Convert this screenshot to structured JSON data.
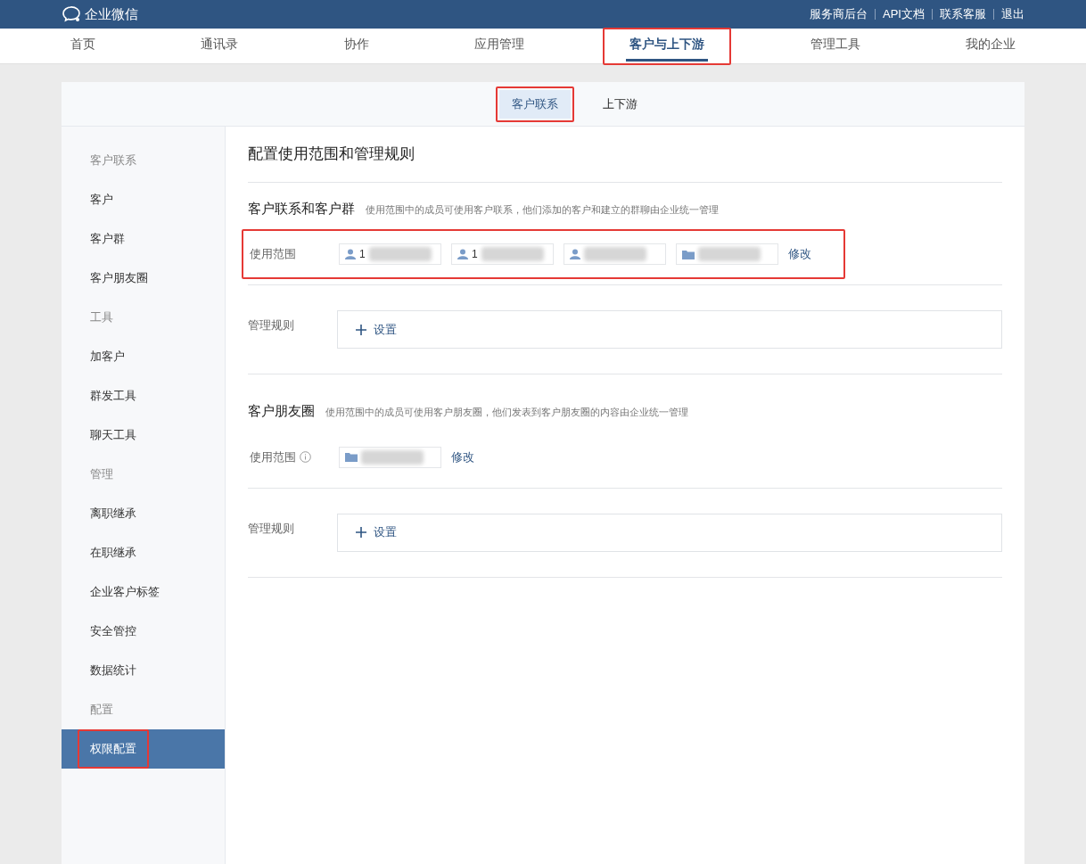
{
  "topbar": {
    "logo": "企业微信",
    "links": [
      "服务商后台",
      "API文档",
      "联系客服",
      "退出"
    ]
  },
  "nav": [
    {
      "label": "首页",
      "selected": false,
      "highlighted": false
    },
    {
      "label": "通讯录",
      "selected": false,
      "highlighted": false
    },
    {
      "label": "协作",
      "selected": false,
      "highlighted": false
    },
    {
      "label": "应用管理",
      "selected": false,
      "highlighted": false
    },
    {
      "label": "客户与上下游",
      "selected": true,
      "highlighted": true
    },
    {
      "label": "管理工具",
      "selected": false,
      "highlighted": false
    },
    {
      "label": "我的企业",
      "selected": false,
      "highlighted": false
    }
  ],
  "subtabs": [
    {
      "label": "客户联系",
      "selected": true,
      "highlighted": true
    },
    {
      "label": "上下游",
      "selected": false,
      "highlighted": false
    }
  ],
  "sidebar": [
    {
      "heading": "客户联系",
      "items": [
        {
          "label": "客户",
          "selected": false,
          "highlighted": false
        },
        {
          "label": "客户群",
          "selected": false,
          "highlighted": false
        },
        {
          "label": "客户朋友圈",
          "selected": false,
          "highlighted": false
        }
      ]
    },
    {
      "heading": "工具",
      "items": [
        {
          "label": "加客户",
          "selected": false,
          "highlighted": false
        },
        {
          "label": "群发工具",
          "selected": false,
          "highlighted": false
        },
        {
          "label": "聊天工具",
          "selected": false,
          "highlighted": false
        }
      ]
    },
    {
      "heading": "管理",
      "items": [
        {
          "label": "离职继承",
          "selected": false,
          "highlighted": false
        },
        {
          "label": "在职继承",
          "selected": false,
          "highlighted": false
        },
        {
          "label": "企业客户标签",
          "selected": false,
          "highlighted": false
        },
        {
          "label": "安全管控",
          "selected": false,
          "highlighted": false
        },
        {
          "label": "数据统计",
          "selected": false,
          "highlighted": false
        }
      ]
    },
    {
      "heading": "配置",
      "items": [
        {
          "label": "权限配置",
          "selected": true,
          "highlighted": true
        }
      ]
    }
  ],
  "page_title": "配置使用范围和管理规则",
  "sections": [
    {
      "title": "客户联系和客户群",
      "description": "使用范围中的成员可使用客户联系，他们添加的客户和建立的群聊由企业统一管理",
      "scope": {
        "label": "使用范围",
        "info": false,
        "highlighted": true,
        "chips": [
          {
            "kind": "person",
            "text": "1"
          },
          {
            "kind": "person",
            "text": "1"
          },
          {
            "kind": "person"
          },
          {
            "kind": "folder"
          }
        ],
        "edit": "修改"
      },
      "rules": {
        "label": "管理规则",
        "button": "设置"
      }
    },
    {
      "title": "客户朋友圈",
      "description": "使用范围中的成员可使用客户朋友圈，他们发表到客户朋友圈的内容由企业统一管理",
      "scope": {
        "label": "使用范围",
        "info": true,
        "highlighted": false,
        "chips": [
          {
            "kind": "folder"
          }
        ],
        "edit": "修改"
      },
      "rules": {
        "label": "管理规则",
        "button": "设置"
      }
    }
  ]
}
